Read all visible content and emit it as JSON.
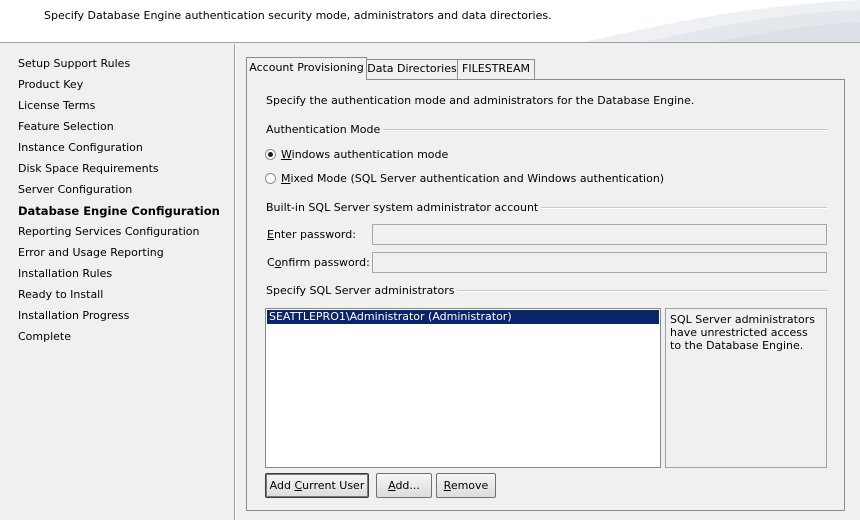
{
  "header": {
    "description": "Specify Database Engine authentication security mode, administrators and data directories."
  },
  "sidebar": {
    "items": [
      {
        "label": "Setup Support Rules",
        "active": false
      },
      {
        "label": "Product Key",
        "active": false
      },
      {
        "label": "License Terms",
        "active": false
      },
      {
        "label": "Feature Selection",
        "active": false
      },
      {
        "label": "Instance Configuration",
        "active": false
      },
      {
        "label": "Disk Space Requirements",
        "active": false
      },
      {
        "label": "Server Configuration",
        "active": false
      },
      {
        "label": "Database Engine Configuration",
        "active": true
      },
      {
        "label": "Reporting Services Configuration",
        "active": false
      },
      {
        "label": "Error and Usage Reporting",
        "active": false
      },
      {
        "label": "Installation Rules",
        "active": false
      },
      {
        "label": "Ready to Install",
        "active": false
      },
      {
        "label": "Installation Progress",
        "active": false
      },
      {
        "label": "Complete",
        "active": false
      }
    ]
  },
  "tabs": [
    {
      "label": "Account Provisioning",
      "active": true
    },
    {
      "label": "Data Directories",
      "active": false
    },
    {
      "label": "FILESTREAM",
      "active": false
    }
  ],
  "panel": {
    "description": "Specify the authentication mode and administrators for the Database Engine.",
    "auth_mode": {
      "title": "Authentication Mode",
      "windows": {
        "mnemonic": "W",
        "rest": "indows authentication mode",
        "checked": true
      },
      "mixed": {
        "mnemonic": "M",
        "rest": "ixed Mode (SQL Server authentication and Windows authentication)",
        "checked": false
      }
    },
    "sa_account": {
      "title": "Built-in SQL Server system administrator account",
      "enter_password": {
        "mnemonic": "E",
        "rest": "nter password:",
        "value": ""
      },
      "confirm_password": {
        "prefix": "C",
        "mnemonic": "o",
        "rest": "nfirm password:",
        "value": ""
      }
    },
    "admins": {
      "title": "Specify SQL Server administrators",
      "list": [
        "SEATTLEPRO1\\Administrator (Administrator)"
      ],
      "info": "SQL Server administrators have unrestricted access to the Database Engine."
    },
    "buttons": {
      "add_current_user": {
        "prefix": "Add ",
        "mnemonic": "C",
        "rest": "urrent User"
      },
      "add": {
        "mnemonic": "A",
        "rest": "dd..."
      },
      "remove": {
        "mnemonic": "R",
        "rest": "emove"
      }
    }
  }
}
